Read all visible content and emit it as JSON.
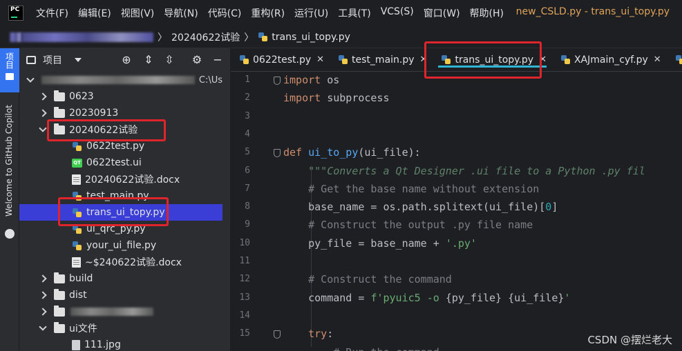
{
  "menubar": {
    "items": [
      "文件(F)",
      "编辑(E)",
      "视图(V)",
      "导航(N)",
      "代码(C)",
      "重构(R)",
      "运行(U)",
      "工具(T)",
      "VCS(S)",
      "窗口(W)",
      "帮助(H)"
    ],
    "window_title": "new_CSLD.py - trans_ui_topy.py"
  },
  "breadcrumb": {
    "folder": "20240622试验",
    "file": "trans_ui_topy.py"
  },
  "tool_strip": {
    "project_label": "项目",
    "copilot_label": "Welcome to GitHub Copilot"
  },
  "project_panel": {
    "title": "项目",
    "root_path": "C:\\Us",
    "tree": [
      {
        "label": "0623",
        "type": "folder",
        "expanded": false,
        "indent": 1
      },
      {
        "label": "20230913",
        "type": "folder",
        "expanded": false,
        "indent": 1
      },
      {
        "label": "20240622试验",
        "type": "folder",
        "expanded": true,
        "indent": 1
      },
      {
        "label": "0622test.py",
        "type": "py",
        "indent": 2
      },
      {
        "label": "0622test.ui",
        "type": "qt",
        "indent": 2
      },
      {
        "label": "20240622试验.docx",
        "type": "doc",
        "indent": 2
      },
      {
        "label": "test_main.py",
        "type": "py",
        "indent": 2
      },
      {
        "label": "trans_ui_topy.py",
        "type": "py",
        "indent": 2,
        "selected": true
      },
      {
        "label": "ui_qrc_py.py",
        "type": "py",
        "indent": 2
      },
      {
        "label": "your_ui_file.py",
        "type": "py",
        "indent": 2
      },
      {
        "label": "~$240622试验.docx",
        "type": "doc",
        "indent": 2
      },
      {
        "label": "build",
        "type": "folder",
        "expanded": false,
        "indent": 1
      },
      {
        "label": "dist",
        "type": "folder",
        "expanded": false,
        "indent": 1
      },
      {
        "label": "",
        "type": "folder-blurred",
        "expanded": false,
        "indent": 1
      },
      {
        "label": "ui文件",
        "type": "folder",
        "expanded": true,
        "indent": 1
      },
      {
        "label": "111.jpg",
        "type": "file",
        "indent": 2
      }
    ]
  },
  "tabs": [
    {
      "label": "0622test.py",
      "active": false
    },
    {
      "label": "test_main.py",
      "active": false
    },
    {
      "label": "trans_ui_topy.py",
      "active": true
    },
    {
      "label": "XAJmain_cyf.py",
      "active": false
    },
    {
      "label": "X",
      "active": false
    }
  ],
  "editor": {
    "line_numbers": [
      "1",
      "2",
      "3",
      "4",
      "5",
      "6",
      "7",
      "8",
      "9",
      "10",
      "11",
      "12",
      "13",
      "14",
      "15"
    ],
    "lines": [
      [
        {
          "t": "import",
          "c": "kw"
        },
        {
          "t": " os",
          "c": ""
        }
      ],
      [
        {
          "t": "import",
          "c": "kw"
        },
        {
          "t": " subprocess",
          "c": ""
        }
      ],
      [],
      [],
      [
        {
          "t": "def ",
          "c": "kw"
        },
        {
          "t": "ui_to_py",
          "c": "fn"
        },
        {
          "t": "(ui_file):",
          "c": ""
        }
      ],
      [
        {
          "t": "    ",
          "c": ""
        },
        {
          "t": "\"\"\"Converts a Qt Designer .ui file to a Python .py fil",
          "c": "docstr"
        }
      ],
      [
        {
          "t": "    ",
          "c": ""
        },
        {
          "t": "# Get the base name without extension",
          "c": "cmt"
        }
      ],
      [
        {
          "t": "    base_name = os.path.splitext(ui_file)[",
          "c": ""
        },
        {
          "t": "0",
          "c": "num"
        },
        {
          "t": "]",
          "c": ""
        }
      ],
      [
        {
          "t": "    ",
          "c": ""
        },
        {
          "t": "# Construct the output .py file name",
          "c": "cmt"
        }
      ],
      [
        {
          "t": "    py_file = base_name + ",
          "c": ""
        },
        {
          "t": "'.py'",
          "c": "str"
        }
      ],
      [],
      [
        {
          "t": "    ",
          "c": ""
        },
        {
          "t": "# Construct the command",
          "c": "cmt"
        }
      ],
      [
        {
          "t": "    command = ",
          "c": ""
        },
        {
          "t": "f'pyuic5 -o ",
          "c": "str"
        },
        {
          "t": "{py_file}",
          "c": ""
        },
        {
          "t": " ",
          "c": "str"
        },
        {
          "t": "{ui_file}",
          "c": ""
        },
        {
          "t": "'",
          "c": "str"
        }
      ],
      [],
      [
        {
          "t": "    ",
          "c": ""
        },
        {
          "t": "try",
          "c": "kw"
        },
        {
          "t": ":",
          "c": ""
        }
      ],
      [
        {
          "t": "        ",
          "c": ""
        },
        {
          "t": "# Run the command",
          "c": "cmt"
        }
      ]
    ]
  },
  "watermark": "CSDN @摆烂老大"
}
